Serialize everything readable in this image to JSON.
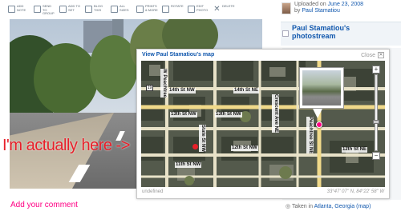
{
  "toolbar": {
    "items": [
      {
        "icon": "note-icon",
        "label": "Add Note"
      },
      {
        "icon": "group-icon",
        "label": "Send to Group"
      },
      {
        "icon": "set-icon",
        "label": "Add to Set"
      },
      {
        "icon": "blog-icon",
        "label": "Blog This"
      },
      {
        "icon": "sizes-icon",
        "label": "All Sizes"
      },
      {
        "icon": "prints-icon",
        "label": "Prints & More"
      },
      {
        "icon": "rotate-icon",
        "label": "Rotate"
      },
      {
        "icon": "edit-icon",
        "label": "Edit Photo"
      },
      {
        "icon": "delete-icon",
        "label": "Delete"
      }
    ]
  },
  "sidebar": {
    "uploaded_on": "Uploaded on",
    "date": "June 23, 2008",
    "by": "by",
    "author": "Paul Stamatiou",
    "stream_title_1": "Paul Stamatiou's",
    "stream_title_2": "photostream"
  },
  "map": {
    "title": "View Paul Stamatiou's map",
    "close_label": "Close",
    "footer_left": "undefined",
    "footer_right": "33°47' 07\" N, 84°22' 58\" W",
    "streets": {
      "s14th": "14th St NW",
      "s14th_b": "14th St NE",
      "s13th": "13th St NW",
      "s13th_b": "13th St NW",
      "s12th": "12th St NW",
      "s12th_b": "12th St NE",
      "s11th": "11th St NW",
      "crescent": "Crescent Ave NE",
      "peachtree": "Peachtree St NE",
      "spring": "W Peachtree",
      "state": "State St NW"
    },
    "shields": [
      "19",
      "9"
    ]
  },
  "annotation": "I'm actually here ->",
  "comment": "Add your comment",
  "taken": {
    "prefix": "Taken in",
    "place": "Atlanta, Georgia",
    "map_link": "(map)"
  }
}
